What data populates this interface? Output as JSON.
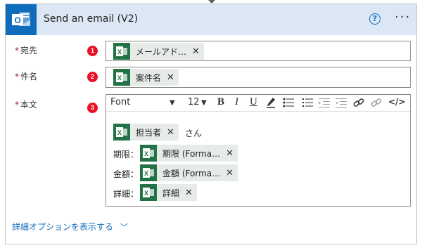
{
  "header": {
    "title": "Send an email (V2)",
    "help_label": "?",
    "more_label": "···"
  },
  "fields": {
    "to": {
      "label": "宛先",
      "required_mark": "*",
      "badge": "1",
      "token": "メールアド…",
      "close": "✕"
    },
    "subject": {
      "label": "件名",
      "required_mark": "*",
      "badge": "2",
      "token": "案件名",
      "close": "✕"
    },
    "body": {
      "label": "本文",
      "required_mark": "*",
      "badge": "3",
      "toolbar": {
        "font": "Font",
        "font_size": "12",
        "bold": "B",
        "italic": "I",
        "underline": "U",
        "code": "</>"
      },
      "lines": [
        {
          "prefix": "",
          "token": "担当者",
          "suffix": "さん"
        },
        {
          "prefix": "期限：",
          "token": "期限 (Forma…",
          "suffix": ""
        },
        {
          "prefix": "金額：",
          "token": "金額 (Forma…",
          "suffix": ""
        },
        {
          "prefix": "詳細：",
          "token": "詳細",
          "suffix": ""
        }
      ],
      "close": "✕"
    }
  },
  "advanced_options": {
    "label": "詳細オプションを表示する",
    "chevron": "﹀"
  },
  "colors": {
    "header_bg": "#dce7f5",
    "outlook_blue": "#0f6cbd",
    "excel_green": "#217346",
    "badge_red": "#e81123"
  },
  "icons": [
    "outlook-icon",
    "help-icon",
    "more-icon",
    "excel-icon",
    "close-icon",
    "pen-icon",
    "bullet-list-icon",
    "numbered-list-icon",
    "outdent-icon",
    "indent-icon",
    "link-icon",
    "unlink-icon",
    "code-icon",
    "chevron-down-icon"
  ]
}
